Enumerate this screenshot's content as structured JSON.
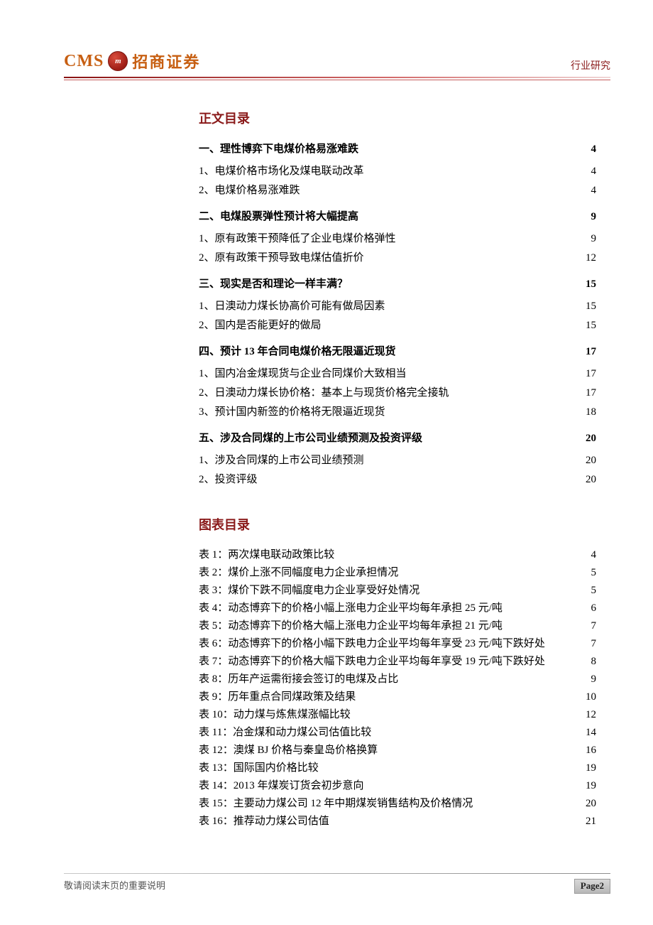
{
  "header": {
    "logo_latin": "CMS",
    "logo_badge": "m",
    "logo_cn": "招商证券",
    "doc_type": "行业研究"
  },
  "toc_title": "正文目录",
  "toc": [
    {
      "level": 1,
      "label": "一、理性博弈下电煤价格易涨难跌",
      "page": "4"
    },
    {
      "level": 2,
      "label": "1、电煤价格市场化及煤电联动改革",
      "page": "4"
    },
    {
      "level": 2,
      "label": "2、电煤价格易涨难跌",
      "page": "4"
    },
    {
      "level": 1,
      "label": "二、电煤股票弹性预计将大幅提高",
      "page": "9"
    },
    {
      "level": 2,
      "label": "1、原有政策干预降低了企业电煤价格弹性",
      "page": "9"
    },
    {
      "level": 2,
      "label": "2、原有政策干预导致电煤估值折价",
      "page": "12"
    },
    {
      "level": 1,
      "label": "三、现实是否和理论一样丰满？",
      "page": "15"
    },
    {
      "level": 2,
      "label": "1、日澳动力煤长协高价可能有做局因素",
      "page": "15"
    },
    {
      "level": 2,
      "label": "2、国内是否能更好的做局",
      "page": "15"
    },
    {
      "level": 1,
      "label": "四、预计 13 年合同电煤价格无限逼近现货",
      "page": "17"
    },
    {
      "level": 2,
      "label": "1、国内冶金煤现货与企业合同煤价大致相当",
      "page": "17"
    },
    {
      "level": 2,
      "label": "2、日澳动力煤长协价格：基本上与现货价格完全接轨",
      "page": "17"
    },
    {
      "level": 2,
      "label": "3、预计国内新签的价格将无限逼近现货",
      "page": "18"
    },
    {
      "level": 1,
      "label": "五、涉及合同煤的上市公司业绩预测及投资评级",
      "page": "20"
    },
    {
      "level": 2,
      "label": "1、涉及合同煤的上市公司业绩预测",
      "page": "20"
    },
    {
      "level": 2,
      "label": "2、投资评级",
      "page": "20"
    }
  ],
  "figs_title": "图表目录",
  "figs": [
    {
      "label": "表 1：两次煤电联动政策比较",
      "page": "4"
    },
    {
      "label": "表 2：煤价上涨不同幅度电力企业承担情况",
      "page": "5"
    },
    {
      "label": "表 3：煤价下跌不同幅度电力企业享受好处情况",
      "page": "5"
    },
    {
      "label": "表 4：动态博弈下的价格小幅上涨电力企业平均每年承担 25 元/吨",
      "page": "6"
    },
    {
      "label": "表 5：动态博弈下的价格大幅上涨电力企业平均每年承担 21 元/吨",
      "page": "7"
    },
    {
      "label": "表 6：动态博弈下的价格小幅下跌电力企业平均每年享受 23 元/吨下跌好处",
      "page": "7"
    },
    {
      "label": "表 7：动态博弈下的价格大幅下跌电力企业平均每年享受 19 元/吨下跌好处",
      "page": "8"
    },
    {
      "label": "表 8：历年产运需衔接会签订的电煤及占比",
      "page": "9"
    },
    {
      "label": "表 9：历年重点合同煤政策及结果",
      "page": "10"
    },
    {
      "label": "表 10：动力煤与炼焦煤涨幅比较",
      "page": "12"
    },
    {
      "label": "表 11：冶金煤和动力煤公司估值比较",
      "page": "14"
    },
    {
      "label": "表 12：澳煤 BJ 价格与秦皇岛价格换算",
      "page": "16"
    },
    {
      "label": "表 13：国际国内价格比较",
      "page": "19"
    },
    {
      "label": "表 14：2013 年煤炭订货会初步意向",
      "page": "19"
    },
    {
      "label": "表 15：主要动力煤公司 12 年中期煤炭销售结构及价格情况",
      "page": "20"
    },
    {
      "label": "表 16：推荐动力煤公司估值",
      "page": "21"
    }
  ],
  "footer": {
    "note": "敬请阅读末页的重要说明",
    "page_label": "Page2"
  }
}
